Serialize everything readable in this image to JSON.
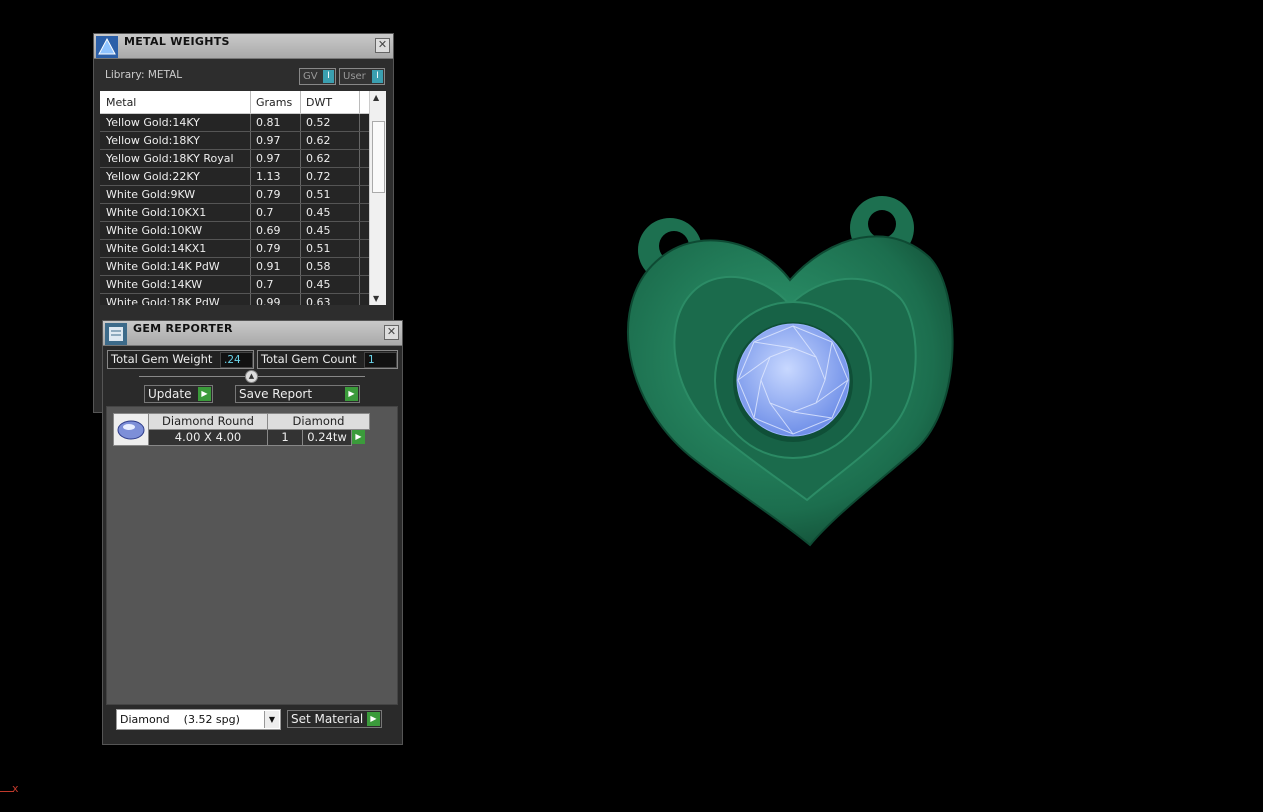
{
  "metal_weights": {
    "title": "METAL WEIGHTS",
    "library_label": "Library: METAL",
    "toggles": [
      {
        "label": "GV",
        "state": "I"
      },
      {
        "label": "User",
        "state": "I"
      }
    ],
    "columns": [
      "Metal",
      "Grams",
      "DWT"
    ],
    "rows": [
      {
        "metal": "Yellow Gold:14KY",
        "grams": "0.81",
        "dwt": "0.52"
      },
      {
        "metal": "Yellow Gold:18KY",
        "grams": "0.97",
        "dwt": "0.62"
      },
      {
        "metal": "Yellow Gold:18KY Royal",
        "grams": "0.97",
        "dwt": "0.62"
      },
      {
        "metal": "Yellow Gold:22KY",
        "grams": "1.13",
        "dwt": "0.72"
      },
      {
        "metal": "White Gold:9KW",
        "grams": "0.79",
        "dwt": "0.51"
      },
      {
        "metal": "White Gold:10KX1",
        "grams": "0.7",
        "dwt": "0.45"
      },
      {
        "metal": "White Gold:10KW",
        "grams": "0.69",
        "dwt": "0.45"
      },
      {
        "metal": "White Gold:14KX1",
        "grams": "0.79",
        "dwt": "0.51"
      },
      {
        "metal": "White Gold:14K PdW",
        "grams": "0.91",
        "dwt": "0.58"
      },
      {
        "metal": "White Gold:14KW",
        "grams": "0.7",
        "dwt": "0.45"
      },
      {
        "metal": "White Gold:18K PdW",
        "grams": "0.99",
        "dwt": "0.63"
      }
    ]
  },
  "gem_reporter": {
    "title": "GEM REPORTER",
    "total_gem_weight_label": "Total Gem Weight",
    "total_gem_weight": ".24",
    "total_gem_count_label": "Total Gem Count",
    "total_gem_count": "1",
    "update_label": "Update",
    "save_report_label": "Save Report",
    "gem": {
      "cut": "Diamond Round",
      "material": "Diamond",
      "size": "4.00 X 4.00",
      "count": "1",
      "weight": "0.24tw"
    },
    "material_select": "Diamond    (3.52 spg)",
    "set_material_label": "Set Material"
  },
  "viewport": {
    "axis_label": "x",
    "colors": {
      "metal": "#1f7a57",
      "gem": "#8fb0f5",
      "background": "#000000"
    }
  }
}
